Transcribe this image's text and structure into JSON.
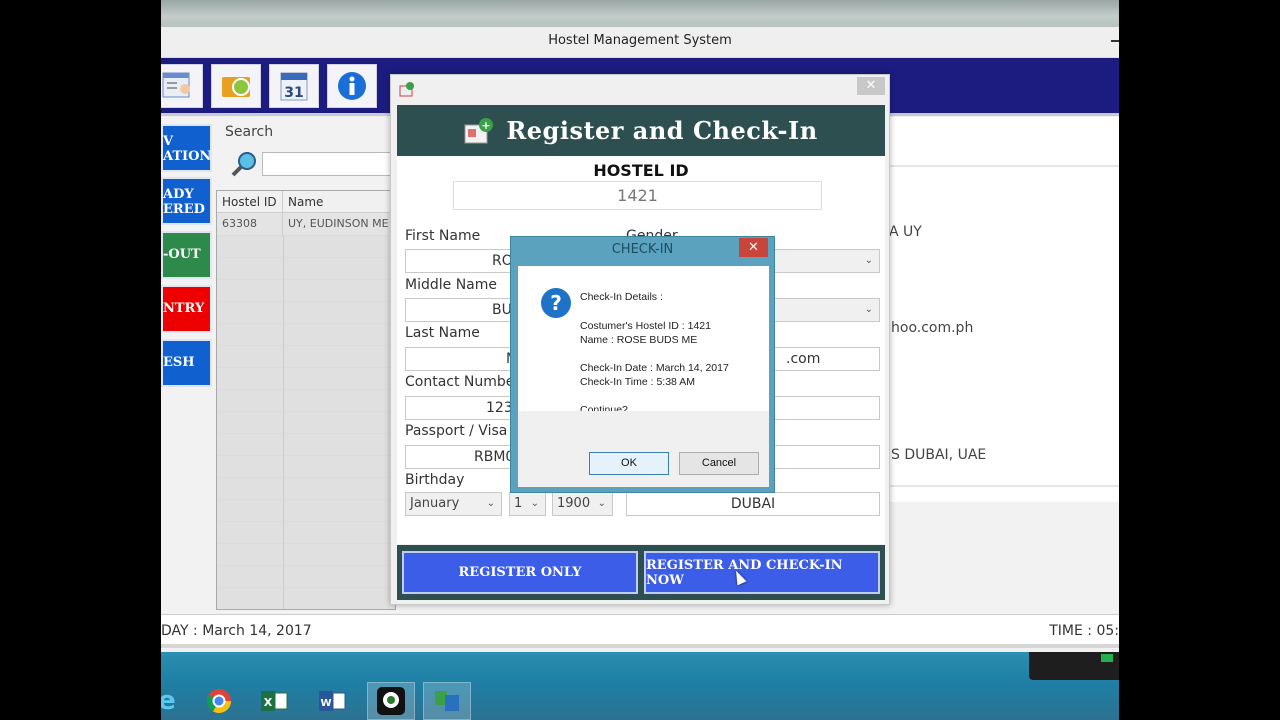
{
  "window": {
    "title": "Hostel Management System"
  },
  "toolbar": {
    "icons": [
      "guest-list-icon",
      "rooms-refresh-icon",
      "calendar-icon",
      "info-icon"
    ],
    "calendar_day": "31"
  },
  "sidebar": {
    "buttons": [
      {
        "label": "NEW\nRESERVATION",
        "visible": "V\nATION",
        "color": "#1060d0"
      },
      {
        "label": "ALREADY\nREGISTERED",
        "visible": "ADY\nERED",
        "color": "#1060d0"
      },
      {
        "label": "CHECK-OUT",
        "visible": "-OUT",
        "color": "#2e8a4a"
      },
      {
        "label": "ENTRY",
        "visible": "NTRY",
        "color": "#ee0000"
      },
      {
        "label": "REFRESH",
        "visible": "ESH",
        "color": "#1060d0"
      }
    ]
  },
  "search": {
    "label": "Search",
    "value": "",
    "placeholder": ""
  },
  "guest_table": {
    "columns": [
      "Hostel ID",
      "Name"
    ],
    "rows": [
      [
        "63308",
        "UY, EUDINSON ME"
      ]
    ]
  },
  "details_panel": {
    "name_fragment": "A UY",
    "email_fragment": "hoo.com.ph",
    "address_fragment": "S DUBAI, UAE"
  },
  "status_bar": {
    "date_text": "DAY : March 14, 2017",
    "time_text": "TIME : 05:"
  },
  "register_dialog": {
    "header_title": "Register and Check-In",
    "hostel_id_label": "HOSTEL ID",
    "hostel_id_value": "1421",
    "fields": {
      "first_name": {
        "label": "First Name",
        "value": "RO"
      },
      "middle_name": {
        "label": "Middle Name",
        "value": "BU"
      },
      "last_name": {
        "label": "Last Name",
        "value": "M"
      },
      "contact_number": {
        "label": "Contact Numbe",
        "value": "1234"
      },
      "passport": {
        "label": "Passport / Visa /",
        "value": "RBM0"
      },
      "birthday": {
        "label": "Birthday",
        "month": "January",
        "day": "1",
        "year": "1900"
      },
      "gender": {
        "label": "Gender"
      },
      "email_value": ".com",
      "city_value": "DUBAI"
    },
    "buttons": {
      "register_only": "REGISTER ONLY",
      "register_checkin": "REGISTER AND CHECK-IN NOW"
    }
  },
  "checkin_box": {
    "title": "CHECK-IN",
    "lines": {
      "heading": "Check-In Details :",
      "hostel_id": "Costumer's Hostel ID : 1421",
      "name": "Name : ROSE BUDS ME",
      "date": "Check-In Date : March 14, 2017",
      "time": "Check-In Time : 5:38 AM",
      "prompt": "Continue?"
    },
    "ok_label": "OK",
    "cancel_label": "Cancel"
  },
  "taskbar": {
    "apps": [
      "internet-explorer-icon",
      "chrome-icon",
      "excel-icon",
      "word-icon",
      "camera-app-icon",
      "hostel-app-icon"
    ]
  }
}
